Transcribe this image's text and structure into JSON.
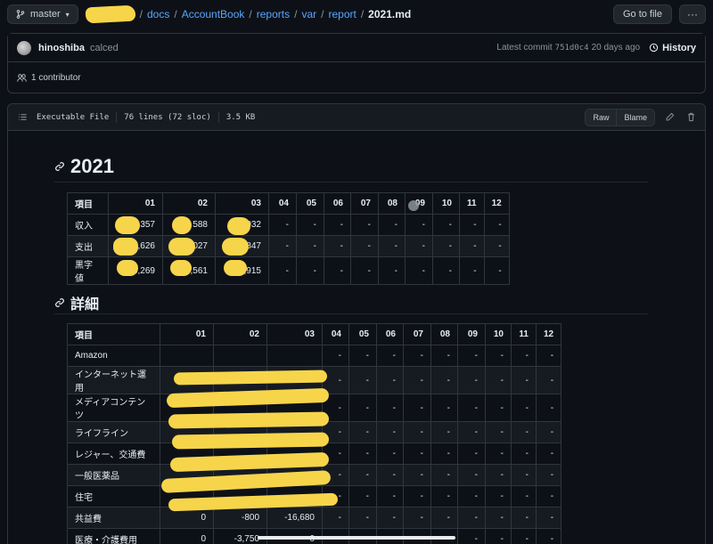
{
  "branch": {
    "label": "master"
  },
  "breadcrumb": {
    "items": [
      "docs",
      "AccountBook",
      "reports",
      "var",
      "report"
    ],
    "file": "2021.md"
  },
  "actions": {
    "goto_file": "Go to file",
    "more": "···"
  },
  "commit": {
    "author": "hinoshiba",
    "message": "calced",
    "latest_label": "Latest commit",
    "sha": "751d0c4",
    "ago": "20 days ago",
    "history": "History"
  },
  "contributors": {
    "label": "1 contributor"
  },
  "file_info": {
    "mode": "Executable File",
    "lines": "76 lines (72 sloc)",
    "size": "3.5 KB",
    "raw": "Raw",
    "blame": "Blame"
  },
  "markdown": {
    "h1": "2021",
    "h2": "詳細"
  },
  "summary_table": {
    "headers": [
      "項目",
      "01",
      "02",
      "03",
      "04",
      "05",
      "06",
      "07",
      "08",
      "09",
      "10",
      "11",
      "12"
    ],
    "rows": [
      [
        "収入",
        "357",
        "588",
        "932",
        "-",
        "-",
        "-",
        "-",
        "-",
        "-",
        "-",
        "-",
        "-"
      ],
      [
        "支出",
        "7,626",
        "027",
        "5,847",
        "-",
        "-",
        "-",
        "-",
        "-",
        "-",
        "-",
        "-",
        "-"
      ],
      [
        "黒字値",
        "6,269",
        "8,561",
        "3,915",
        "-",
        "-",
        "-",
        "-",
        "-",
        "-",
        "-",
        "-",
        "-"
      ]
    ]
  },
  "detail_table": {
    "headers": [
      "項目",
      "01",
      "02",
      "03",
      "04",
      "05",
      "06",
      "07",
      "08",
      "09",
      "10",
      "11",
      "12"
    ],
    "rows": [
      [
        "Amazon",
        "",
        "",
        "",
        "-",
        "-",
        "-",
        "-",
        "-",
        "-",
        "-",
        "-",
        "-"
      ],
      [
        "インターネット運用",
        "",
        "",
        "",
        "-",
        "-",
        "-",
        "-",
        "-",
        "-",
        "-",
        "-",
        "-"
      ],
      [
        "メディアコンテンツ",
        "",
        "",
        "",
        "-",
        "-",
        "-",
        "-",
        "-",
        "-",
        "-",
        "-",
        "-"
      ],
      [
        "ライフライン",
        "",
        "",
        "",
        "-",
        "-",
        "-",
        "-",
        "-",
        "-",
        "-",
        "-",
        "-"
      ],
      [
        "レジャー、交通費",
        "",
        "",
        "",
        "-",
        "-",
        "-",
        "-",
        "-",
        "-",
        "-",
        "-",
        "-"
      ],
      [
        "一般医薬品",
        "",
        "",
        "",
        "-",
        "-",
        "-",
        "-",
        "-",
        "-",
        "-",
        "-",
        "-"
      ],
      [
        "住宅",
        "",
        "",
        "",
        "-",
        "-",
        "-",
        "-",
        "-",
        "-",
        "-",
        "-",
        "-"
      ],
      [
        "共益費",
        "0",
        "-800",
        "-16,680",
        "-",
        "-",
        "-",
        "-",
        "-",
        "-",
        "-",
        "-",
        "-"
      ],
      [
        "医療・介護費用",
        "0",
        "-3,750",
        "0",
        "-",
        "-",
        "-",
        "-",
        "-",
        "-",
        "-",
        "-",
        "-"
      ]
    ]
  }
}
